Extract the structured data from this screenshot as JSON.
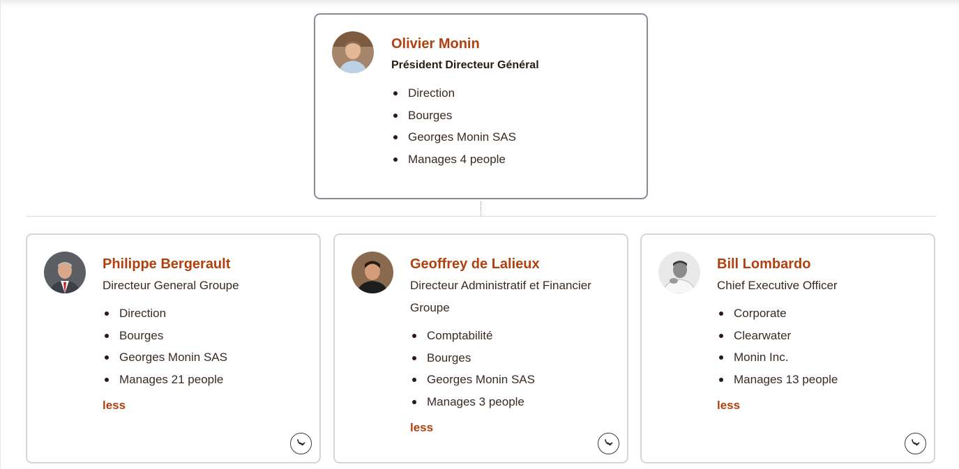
{
  "root": {
    "name": "Olivier Monin",
    "title": "Président Directeur Général",
    "facts": [
      "Direction",
      "Bourges",
      "Georges Monin SAS",
      "Manages 4 people"
    ]
  },
  "reports": [
    {
      "name": "Philippe Bergerault",
      "title": "Directeur General Groupe",
      "facts": [
        "Direction",
        "Bourges",
        "Georges Monin SAS",
        "Manages 21 people"
      ],
      "less_label": "less"
    },
    {
      "name": "Geoffrey de Lalieux",
      "title": "Directeur Administratif et Financier Groupe",
      "facts": [
        "Comptabilité",
        "Bourges",
        "Georges Monin SAS",
        "Manages 3 people"
      ],
      "less_label": "less"
    },
    {
      "name": "Bill Lombardo",
      "title": "Chief Executive Officer",
      "facts": [
        "Corporate",
        "Clearwater",
        "Monin Inc.",
        "Manages 13 people"
      ],
      "less_label": "less"
    }
  ],
  "icons": {
    "expand": "arrow-turn-down-right-icon",
    "avatar": "person-photo"
  },
  "colors": {
    "name": "#b0400d",
    "root_border": "#878b93",
    "card_border": "#d5d5d5"
  }
}
